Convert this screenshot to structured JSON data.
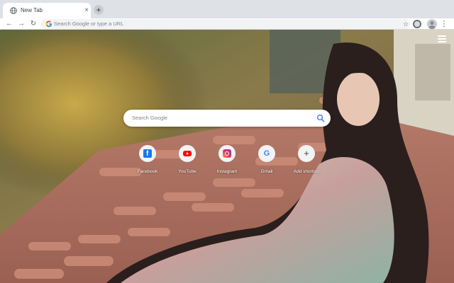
{
  "browser": {
    "tab": {
      "title": "New Tab",
      "close_glyph": "×",
      "favicon": "globe-icon"
    },
    "new_tab_glyph": "+",
    "toolbar": {
      "back_glyph": "←",
      "forward_glyph": "→",
      "reload_glyph": "↻",
      "omnibox_placeholder": "Search Google or type a URL",
      "star_glyph": "☆",
      "menu_glyph": "⋮"
    }
  },
  "ntp": {
    "search_placeholder": "Search Google",
    "shortcuts": [
      {
        "label": "Facebook",
        "icon": "facebook-icon"
      },
      {
        "label": "YouTube",
        "icon": "youtube-icon"
      },
      {
        "label": "Instagram",
        "icon": "instagram-icon"
      },
      {
        "label": "Gmail",
        "icon": "google-icon",
        "glyph": "G"
      },
      {
        "label": "Add shortcut",
        "icon": "plus-icon",
        "glyph": "+"
      }
    ]
  },
  "colors": {
    "tabstrip": "#dee1e6",
    "toolbar": "#ffffff",
    "omnibox": "#f1f3f4",
    "accent_blue": "#4285f4"
  }
}
